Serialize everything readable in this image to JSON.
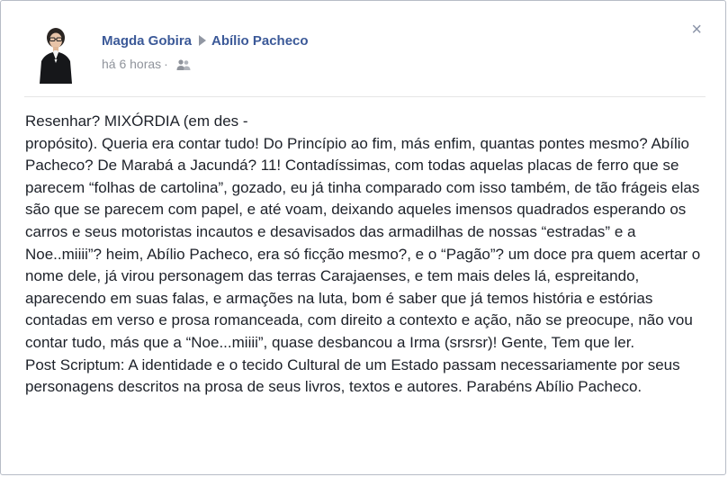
{
  "post": {
    "author_name": "Magda Gobira",
    "target_name": "Abílio Pacheco",
    "timestamp": "há 6 horas",
    "separator": "·",
    "audience_icon": "friends-icon",
    "close_label": "×",
    "body_lines": [
      "Resenhar? MIXÓRDIA (em des -\npropósito). Queria era contar tudo! Do Princípio ao fim, más enfim, quantas pontes mesmo? Abílio Pacheco? De Marabá a Jacundá? 11! Contadíssimas, com todas aquelas placas de ferro que se parecem “folhas de cartolina”, gozado, eu já tinha comparado com isso também, de tão frágeis elas são que se parecem com papel, e até voam, deixando aqueles imensos quadrados esperando os carros e seus motoristas incautos e desavisados das armadilhas de nossas “estradas” e a Noe..miiii”? heim, Abílio Pacheco, era só ficção mesmo?, e o “Pagão”? um doce pra quem acertar o nome dele, já virou personagem das terras Carajaenses, e tem mais deles lá, espreitando, aparecendo em suas falas, e armações na luta, bom é saber que já temos história e estórias contadas em verso e prosa romanceada, com direito a contexto e ação, não se preocupe, não vou contar tudo, más que a “Noe...miiii”, quase desbancou a Irma (srsrsr)! Gente, Tem que ler.",
      "Post Scriptum: A identidade e o tecido Cultural de um Estado passam necessariamente por seus personagens descritos na prosa de seus livros, textos e autores. Parabéns Abílio Pacheco."
    ]
  },
  "colors": {
    "link": "#3b5998",
    "meta": "#90949c",
    "text": "#1d2129",
    "border": "#b7bcc6"
  }
}
